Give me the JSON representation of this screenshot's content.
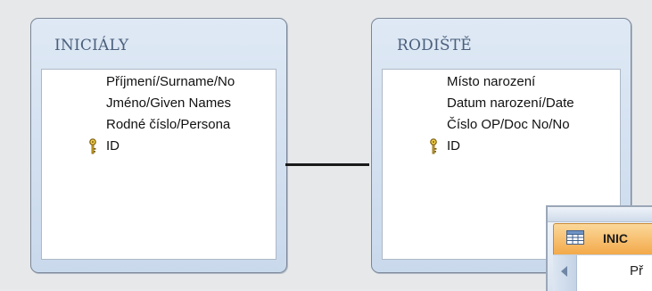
{
  "tables": [
    {
      "title": "INICIÁLY",
      "fields": [
        {
          "name": "Příjmení/Surname/No",
          "primary_key": false
        },
        {
          "name": "Jméno/Given Names",
          "primary_key": false
        },
        {
          "name": "Rodné číslo/Persona",
          "primary_key": false
        },
        {
          "name": "ID",
          "primary_key": true
        }
      ]
    },
    {
      "title": "RODIŠTĚ",
      "fields": [
        {
          "name": "Místo narození",
          "primary_key": false
        },
        {
          "name": "Datum narození/Date",
          "primary_key": false
        },
        {
          "name": "Číslo OP/Doc No/No",
          "primary_key": false
        },
        {
          "name": "ID",
          "primary_key": true
        }
      ]
    }
  ],
  "datasheet_tab": {
    "label": "INIC",
    "first_cell": "Př"
  },
  "colors": {
    "canvas_background": "#e6e8ea",
    "table_header": "#c9d9ec",
    "tab_active": "#f3a94a",
    "relationship_line": "#1a1a1a"
  },
  "icons": [
    "key-icon",
    "table-icon"
  ]
}
